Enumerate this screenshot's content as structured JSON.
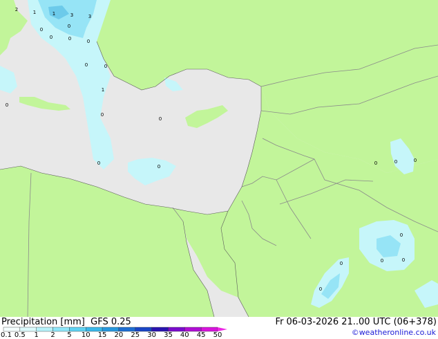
{
  "title": "Precipitation [mm]  GFS 0.25",
  "valid_time": "Fr 06-03-2026 21..00 UTC (06+378)",
  "credit": "©weatheronline.co.uk",
  "legend": {
    "labels": [
      "0.1",
      "0.5",
      "1",
      "2",
      "5",
      "10",
      "15",
      "20",
      "25",
      "30",
      "35",
      "40",
      "45",
      "50"
    ],
    "colors": [
      "#f5fefe",
      "#dcfafc",
      "#b6f2fa",
      "#8ee6f8",
      "#5fd2f2",
      "#3ab8ea",
      "#2898de",
      "#1e6ed2",
      "#1a46c6",
      "#2a14b0",
      "#7a0ccc",
      "#b00ed4",
      "#d814dc",
      "#ec28e4"
    ]
  },
  "colors": {
    "land": "#c2f59a",
    "sea": "#e8e8e8",
    "border": "#8a8a8a",
    "precip_light": "#c6f6fa",
    "precip_mid": "#96e4f6",
    "precip_heavy": "#6ccaea"
  },
  "precip_values": [
    "2",
    "1",
    "1",
    "3",
    "3",
    "0",
    "0",
    "0",
    "0",
    "0",
    "1",
    "0",
    "0",
    "0",
    "0",
    "0",
    "0",
    "0",
    "0",
    "0",
    "0",
    "0",
    "0",
    "0",
    "0",
    "0"
  ]
}
